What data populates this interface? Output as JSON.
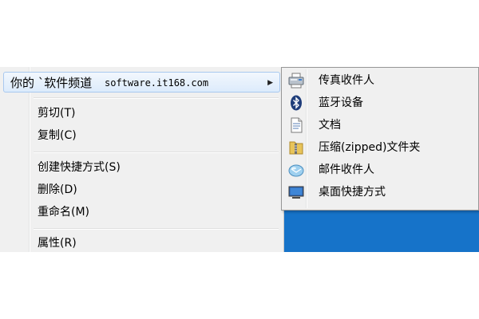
{
  "menu": {
    "highlighted": {
      "label": "你的 `软件频道",
      "url": "software.it168.com",
      "arrow": "▶"
    },
    "items": [
      {
        "label": "剪切(T)"
      },
      {
        "label": "复制(C)"
      },
      {
        "label": "创建快捷方式(S)"
      },
      {
        "label": "删除(D)"
      },
      {
        "label": "重命名(M)"
      },
      {
        "label": "属性(R)"
      }
    ]
  },
  "submenu": {
    "items": [
      {
        "label": "传真收件人",
        "icon": "fax-icon"
      },
      {
        "label": "蓝牙设备",
        "icon": "bluetooth-icon"
      },
      {
        "label": "文档",
        "icon": "document-icon"
      },
      {
        "label": "压缩(zipped)文件夹",
        "icon": "zip-folder-icon"
      },
      {
        "label": "邮件收件人",
        "icon": "mail-icon"
      },
      {
        "label": "桌面快捷方式",
        "icon": "desktop-icon"
      }
    ]
  },
  "colors": {
    "desktop": "#1673c9",
    "menu_bg": "#f0f0f0",
    "highlight_border": "#a9c9ef"
  }
}
